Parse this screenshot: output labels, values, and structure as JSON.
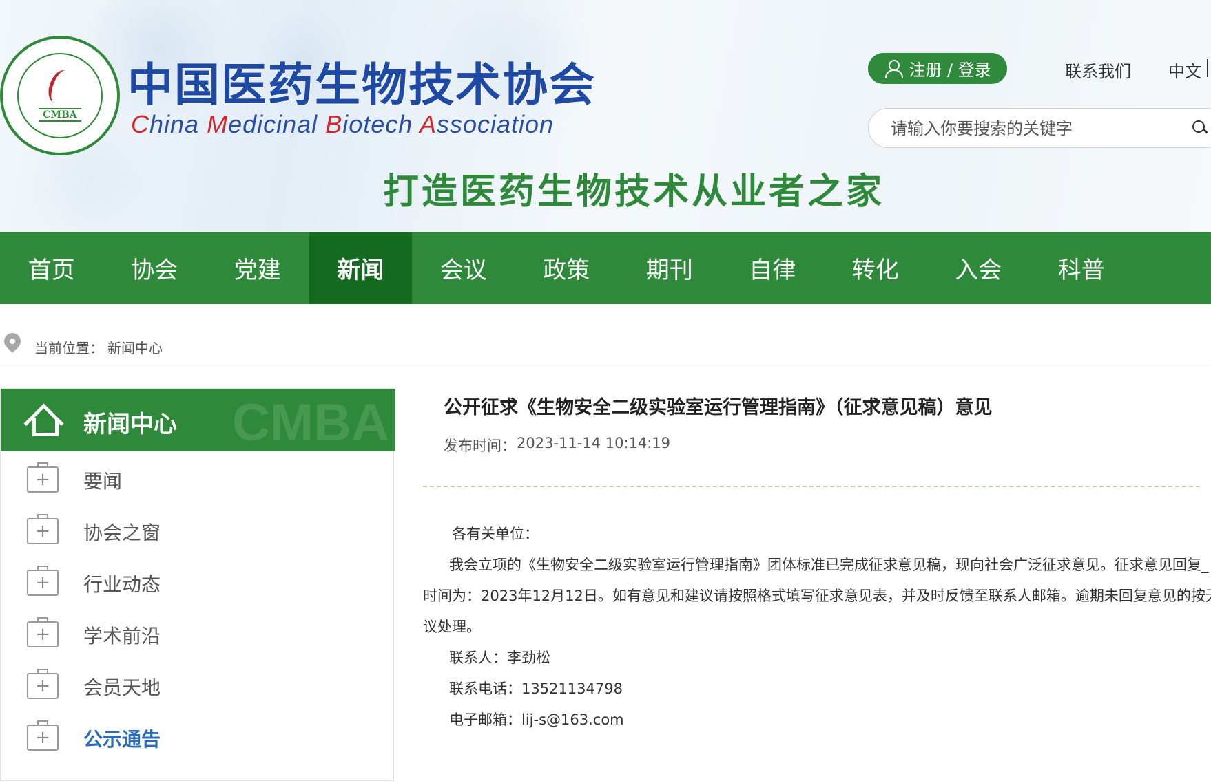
{
  "header": {
    "logo_abbr": "CMBA",
    "title_cn": "中国医药生物技术协会",
    "title_en_words": [
      {
        "cap": "C",
        "rest": "hina"
      },
      {
        "cap": "M",
        "rest": "edicinal"
      },
      {
        "cap": "B",
        "rest": "iotech"
      },
      {
        "cap": "A",
        "rest": "ssociation"
      }
    ],
    "slogan": "打造医药生物技术从业者之家",
    "login_label": "注册 / 登录",
    "contact_label": "联系我们",
    "lang_label": "中文",
    "search_placeholder": "请输入你要搜索的关键字"
  },
  "nav": {
    "items": [
      {
        "label": "首页"
      },
      {
        "label": "协会"
      },
      {
        "label": "党建"
      },
      {
        "label": "新闻"
      },
      {
        "label": "会议"
      },
      {
        "label": "政策"
      },
      {
        "label": "期刊"
      },
      {
        "label": "自律"
      },
      {
        "label": "转化"
      },
      {
        "label": "入会"
      },
      {
        "label": "科普"
      }
    ],
    "active": "新闻"
  },
  "breadcrumb": {
    "label": "当前位置：",
    "current": "新闻中心"
  },
  "sidebar": {
    "title": "新闻中心",
    "watermark": "CMBA",
    "items": [
      {
        "label": "要闻"
      },
      {
        "label": "协会之窗"
      },
      {
        "label": "行业动态"
      },
      {
        "label": "学术前沿"
      },
      {
        "label": "会员天地"
      },
      {
        "label": "公示通告"
      }
    ],
    "active": "公示通告"
  },
  "article": {
    "title": "公开征求《生物安全二级实验室运行管理指南》（征求意见稿）意见",
    "date_label": "发布时间：",
    "date": "2023-11-14 10:14:19",
    "salutation": "各有关单位：",
    "body_lines": [
      "我会立项的《生物安全二级实验室运行管理指南》团体标准已完成征求意见稿，现向社会广泛征求意见。征求意见回复_",
      "时间为：2023年12月12日。如有意见和建议请按照格式填写征求意见表，并及时反馈至联系人邮箱。逾期未回复意见的按无",
      "议处理。"
    ],
    "contact_person": "联系人：李劲松",
    "contact_phone": "联系电话：13521134798",
    "contact_email": "电子邮箱：lij-s@163.com"
  },
  "colors": {
    "brand_green": "#2e8a3a",
    "active_nav": "#146a1f",
    "title_blue": "#1e4aa6",
    "accent_red": "#d1262b",
    "active_link": "#2b6cb8"
  }
}
